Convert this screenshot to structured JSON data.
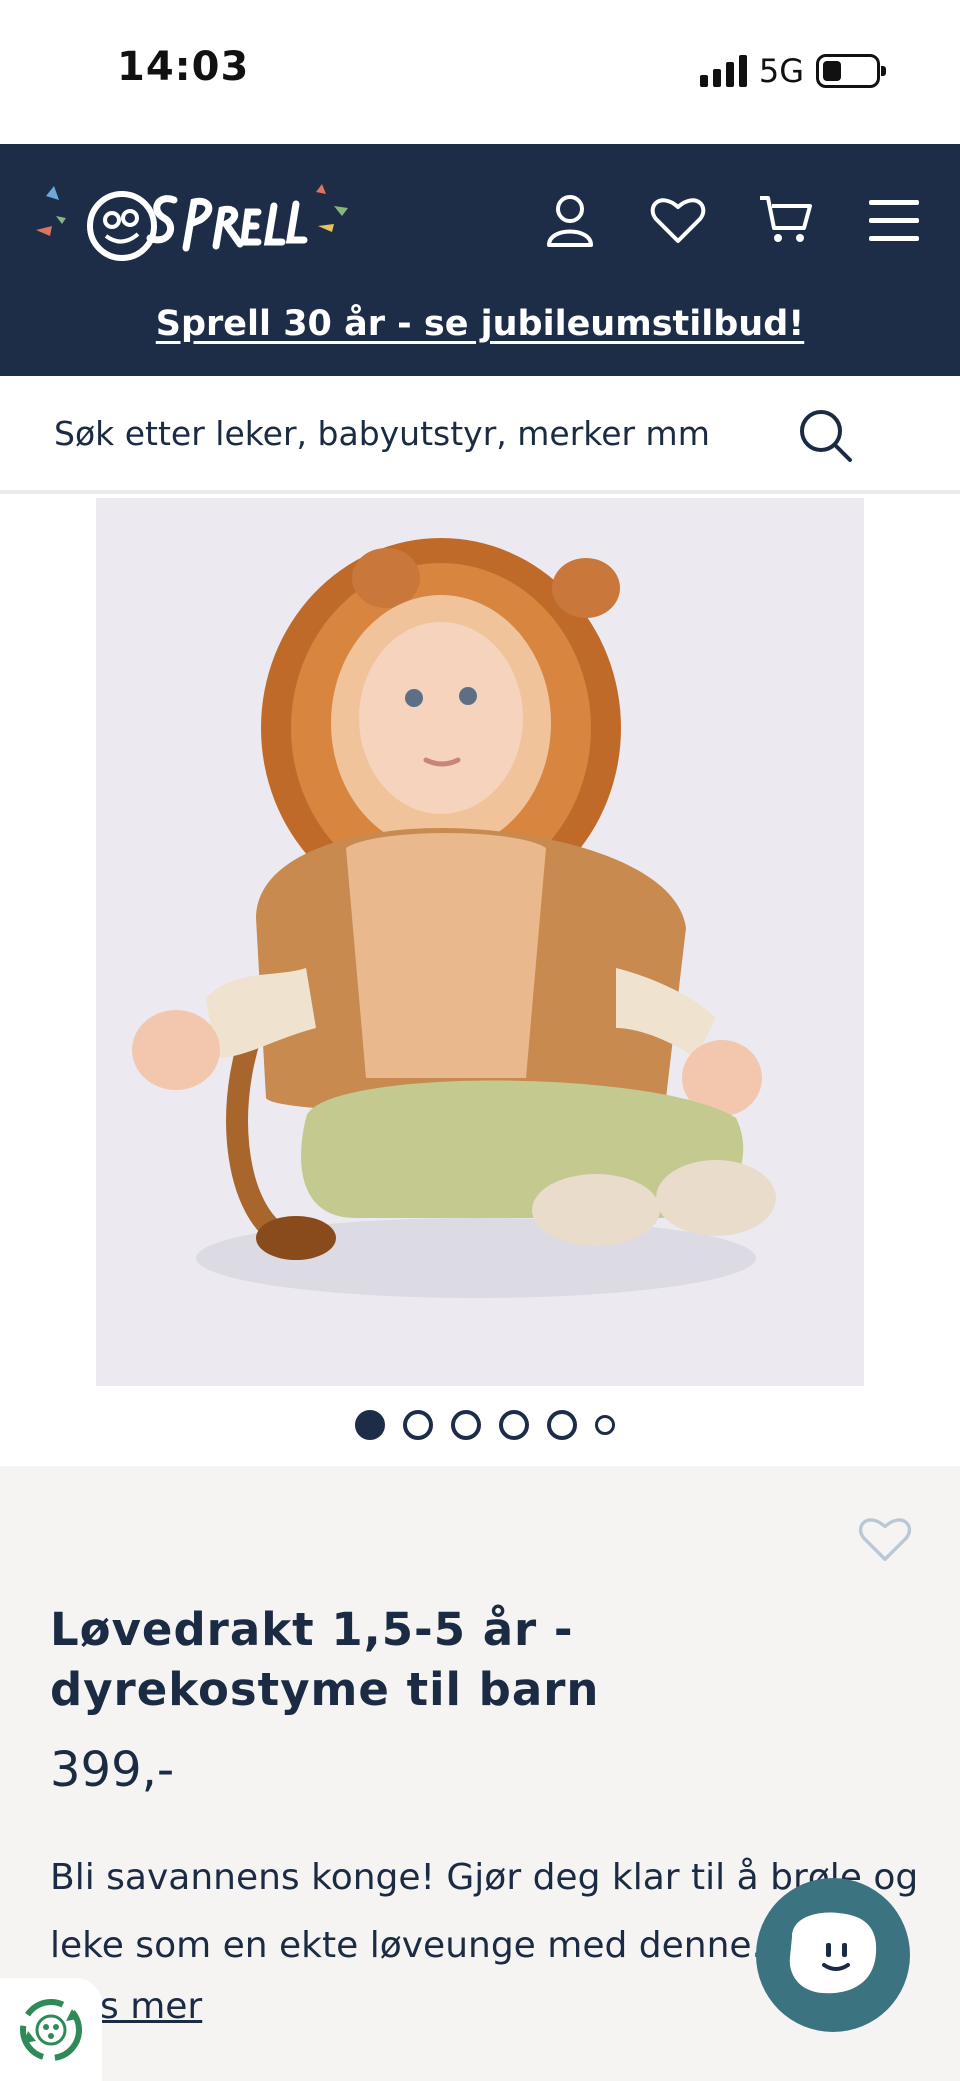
{
  "status_bar": {
    "time": "14:03",
    "network": "5G"
  },
  "header": {
    "logo_alt": "Sprell",
    "promo_text": "Sprell 30 år - se jubileumstilbud!",
    "icons": [
      "account-icon",
      "heart-icon",
      "cart-icon",
      "menu-icon"
    ],
    "background_color": "#1d2d48"
  },
  "search": {
    "placeholder": "Søk etter leker, babyutstyr, merker mm"
  },
  "gallery": {
    "image_description_name": "product-image",
    "slide_count": 6,
    "active_slide": 1
  },
  "product": {
    "title": "Løvedrakt 1,5-5 år - dyrekostyme til barn",
    "price": "399,-",
    "description": "Bli savannens konge! Gjør deg klar til å brøle og leke som en ekte løveunge med denne..",
    "read_more": "s mer"
  },
  "colors": {
    "navy": "#1d2d48",
    "chat_teal": "#3c7380",
    "info_bg": "#f5f4f2"
  }
}
